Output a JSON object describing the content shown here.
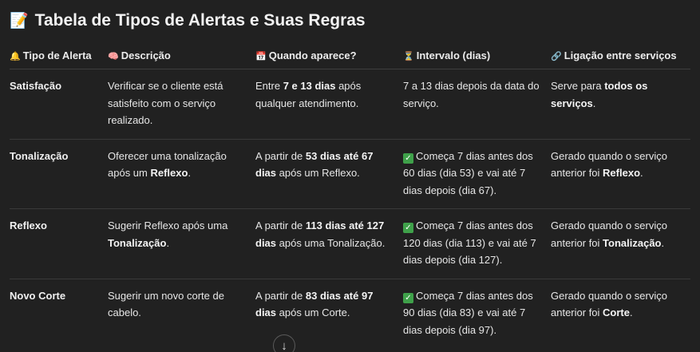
{
  "title": {
    "icon": "📝",
    "text": "Tabela de Tipos de Alertas e Suas Regras"
  },
  "headers": [
    {
      "icon": "🔔",
      "label": "Tipo de Alerta"
    },
    {
      "icon": "🧠",
      "label": "Descrição"
    },
    {
      "icon": "📅",
      "label": "Quando aparece?"
    },
    {
      "icon": "⏳",
      "label": "Intervalo (dias)"
    },
    {
      "icon": "🔗",
      "label": "Ligação entre serviços"
    }
  ],
  "rows": [
    {
      "type": "Satisfação",
      "desc": [
        "Verificar se o cliente está satisfeito com o serviço realizado."
      ],
      "when": [
        "Entre ",
        "7 e 13 dias",
        " após qualquer atendimento."
      ],
      "interval_check": false,
      "interval": "7 a 13 dias depois da data do serviço.",
      "link": [
        "Serve para ",
        "todos os serviços",
        "."
      ]
    },
    {
      "type": "Tonalização",
      "desc": [
        "Oferecer uma tonalização após um ",
        "Reflexo",
        "."
      ],
      "when": [
        "A partir de ",
        "53 dias até 67 dias",
        " após um Reflexo."
      ],
      "interval_check": true,
      "interval": "Começa 7 dias antes dos 60 dias (dia 53) e vai até 7 dias depois (dia 67).",
      "link": [
        "Gerado quando o serviço anterior foi ",
        "Reflexo",
        "."
      ]
    },
    {
      "type": "Reflexo",
      "desc": [
        "Sugerir Reflexo após uma ",
        "Tonalização",
        "."
      ],
      "when": [
        "A partir de ",
        "113 dias até 127 dias",
        " após uma Tonalização."
      ],
      "interval_check": true,
      "interval": "Começa 7 dias antes dos 120 dias (dia 113) e vai até 7 dias depois (dia 127).",
      "link": [
        "Gerado quando o serviço anterior foi ",
        "Tonalização",
        "."
      ]
    },
    {
      "type": "Novo Corte",
      "desc": [
        "Sugerir um novo corte de cabelo."
      ],
      "when": [
        "A partir de ",
        "83 dias até 97 dias",
        " após um Corte."
      ],
      "interval_check": true,
      "interval": "Começa 7 dias antes dos 90 dias (dia 83) e vai até 7 dias depois (dia 97).",
      "link": [
        "Gerado quando o serviço anterior foi ",
        "Corte",
        "."
      ]
    }
  ],
  "scroll_button": {
    "icon": "arrow-down-icon",
    "glyph": "↓"
  }
}
